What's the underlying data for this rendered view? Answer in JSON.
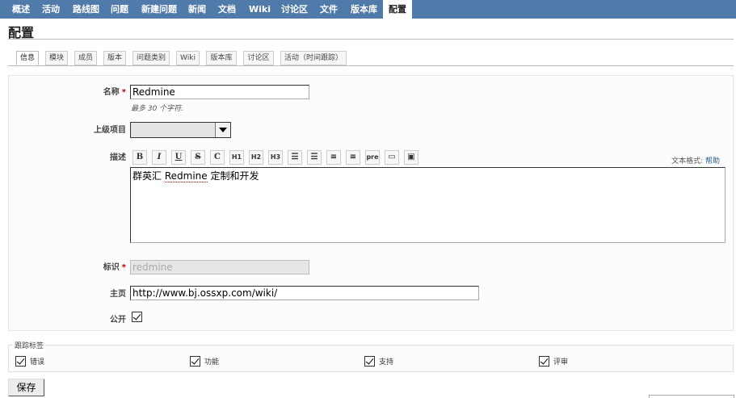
{
  "top_menu": {
    "items": [
      "概述",
      "活动",
      "路线图",
      "问题",
      "新建问题",
      "新闻",
      "文档",
      "Wiki",
      "讨论区",
      "文件",
      "版本库",
      "配置"
    ],
    "selected": "配置"
  },
  "page_title": "配置",
  "tabs": {
    "items": [
      "信息",
      "模块",
      "成员",
      "版本",
      "问题类别",
      "Wiki",
      "版本库",
      "讨论区",
      "活动（时间跟踪）"
    ],
    "selected": "信息"
  },
  "form": {
    "name_label": "名称",
    "required_mark": "*",
    "name_value": "Redmine",
    "name_hint": "最多 30 个字符.",
    "parent_label": "上级项目",
    "parent_value": "",
    "description_label": "描述",
    "toolbar": [
      {
        "icon": "bold-icon",
        "glyph": "B"
      },
      {
        "icon": "italic-icon",
        "glyph": "I"
      },
      {
        "icon": "underline-icon",
        "glyph": "U"
      },
      {
        "icon": "strikethrough-icon",
        "glyph": "S"
      },
      {
        "icon": "code-icon",
        "glyph": "C"
      },
      {
        "icon": "heading1-icon",
        "glyph": "H1"
      },
      {
        "icon": "heading2-icon",
        "glyph": "H2"
      },
      {
        "icon": "heading3-icon",
        "glyph": "H3"
      },
      {
        "icon": "unordered-list-icon",
        "glyph": "☰"
      },
      {
        "icon": "ordered-list-icon",
        "glyph": "☰"
      },
      {
        "icon": "quote-icon",
        "glyph": "≡"
      },
      {
        "icon": "unquote-icon",
        "glyph": "≡"
      },
      {
        "icon": "preformatted-icon",
        "glyph": "pre"
      },
      {
        "icon": "wiki-link-icon",
        "glyph": "▭"
      },
      {
        "icon": "image-icon",
        "glyph": "▣"
      }
    ],
    "text_format_label": "文本格式:",
    "help_link": "帮助",
    "description_prefix": "群英汇 ",
    "description_word": "Redmine",
    "description_suffix": " 定制和开发",
    "identifier_label": "标识",
    "identifier_value": "redmine",
    "homepage_label": "主页",
    "homepage_value": "http://www.bj.ossxp.com/wiki/",
    "public_label": "公开",
    "public_checked": true
  },
  "trackers": {
    "legend": "跟踪标签",
    "items": [
      {
        "label": "错误",
        "checked": true
      },
      {
        "label": "功能",
        "checked": true
      },
      {
        "label": "支持",
        "checked": true
      },
      {
        "label": "评审",
        "checked": true
      }
    ]
  },
  "save_label": "保存",
  "colors": {
    "menu_bar": "#507aaa",
    "required": "#bb0000",
    "link": "#2a5a8a"
  }
}
